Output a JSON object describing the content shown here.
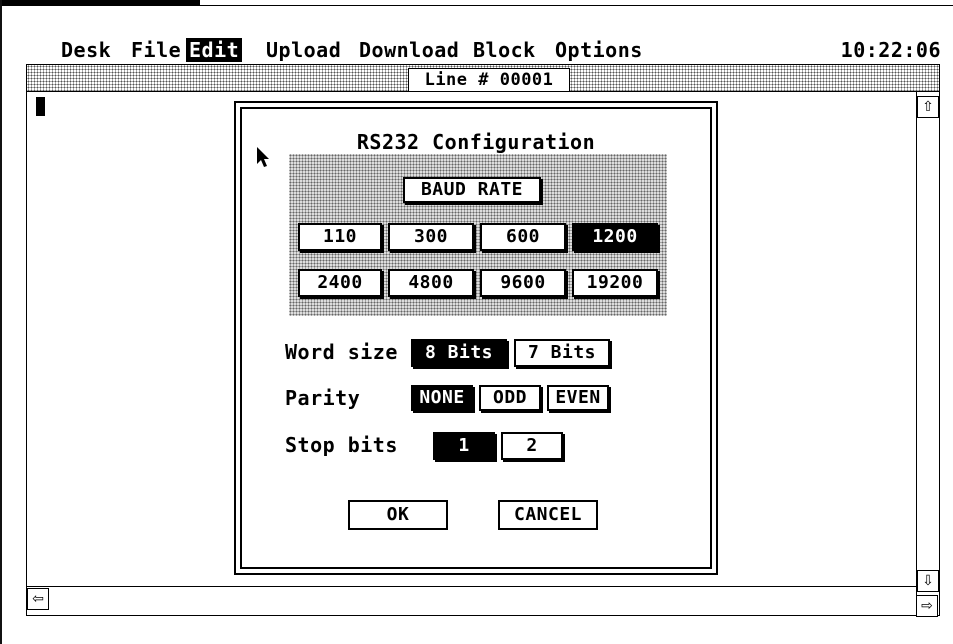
{
  "menubar": {
    "items": [
      "Desk",
      "File",
      "Edit",
      "Upload",
      "Download",
      "Block",
      "Options"
    ],
    "active": "Edit",
    "clock": "10:22:06"
  },
  "window": {
    "title": "Line # 00001"
  },
  "scroll_icons": {
    "up": "up-arrow-icon",
    "down": "down-arrow-icon",
    "left": "left-arrow-icon",
    "right": "right-arrow-icon"
  },
  "dialog": {
    "title": "RS232 Configuration",
    "baud_rate_label": "BAUD RATE",
    "baud_rates": [
      "110",
      "300",
      "600",
      "1200",
      "2400",
      "4800",
      "9600",
      "19200"
    ],
    "baud_selected": "1200",
    "word_size_label": "Word size",
    "word_size_options": [
      "8 Bits",
      "7 Bits"
    ],
    "word_size_selected": "8 Bits",
    "parity_label": "Parity",
    "parity_options": [
      "NONE",
      "ODD",
      "EVEN"
    ],
    "parity_selected": "NONE",
    "stop_bits_label": "Stop bits",
    "stop_bits_options": [
      "1",
      "2"
    ],
    "stop_bits_selected": "1",
    "ok_label": "OK",
    "cancel_label": "CANCEL"
  }
}
